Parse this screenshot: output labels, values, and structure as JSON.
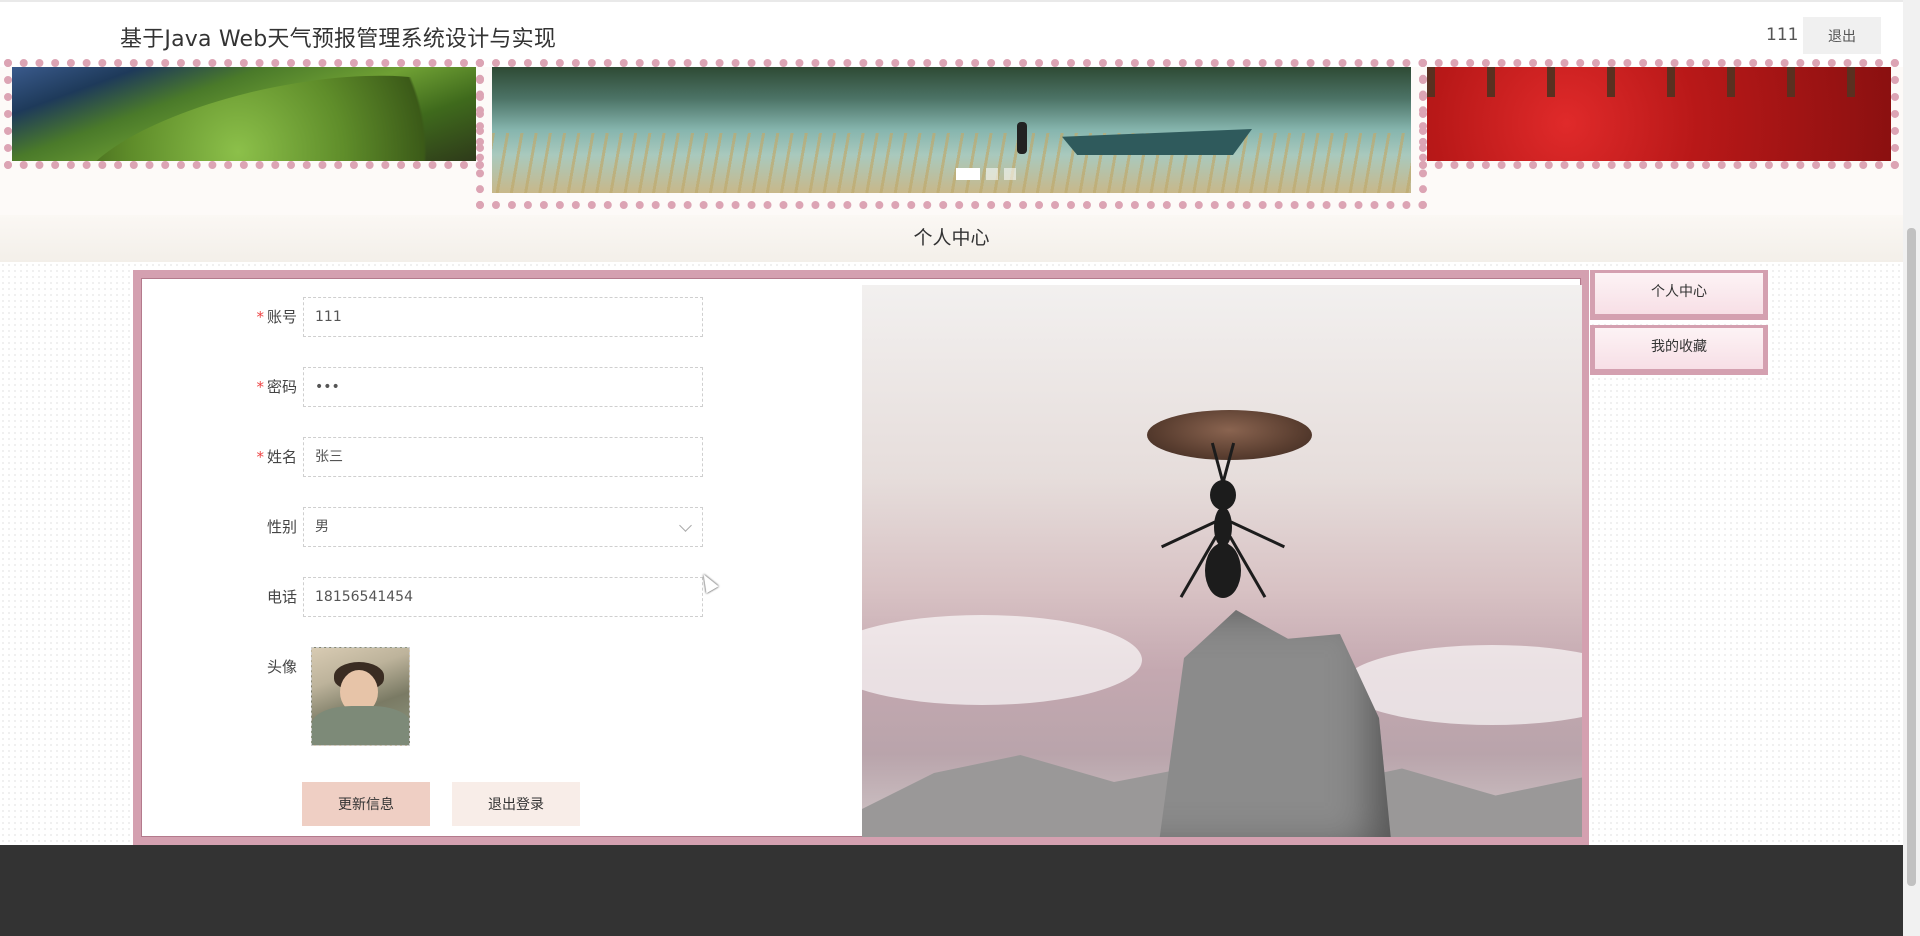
{
  "header": {
    "title": "基于Java Web天气预报管理系统设计与实现",
    "username": "111",
    "logout_label": "退出"
  },
  "carousel": {
    "slide_count": 3,
    "active_slide": 1
  },
  "section": {
    "title": "个人中心"
  },
  "form": {
    "account": {
      "label": "账号",
      "value": "111",
      "required": true
    },
    "password": {
      "label": "密码",
      "value": "•••",
      "required": true
    },
    "name": {
      "label": "姓名",
      "value": "张三",
      "required": true
    },
    "gender": {
      "label": "性别",
      "value": "男"
    },
    "phone": {
      "label": "电话",
      "value": "18156541454"
    },
    "avatar": {
      "label": "头像"
    },
    "update_label": "更新信息",
    "signout_label": "退出登录",
    "required_mark": "*"
  },
  "sidebar": {
    "items": [
      {
        "label": "个人中心"
      },
      {
        "label": "我的收藏"
      }
    ]
  },
  "colors": {
    "accent": "#d4a0b0",
    "footer": "#333333",
    "update_button": "#efcfc4"
  }
}
